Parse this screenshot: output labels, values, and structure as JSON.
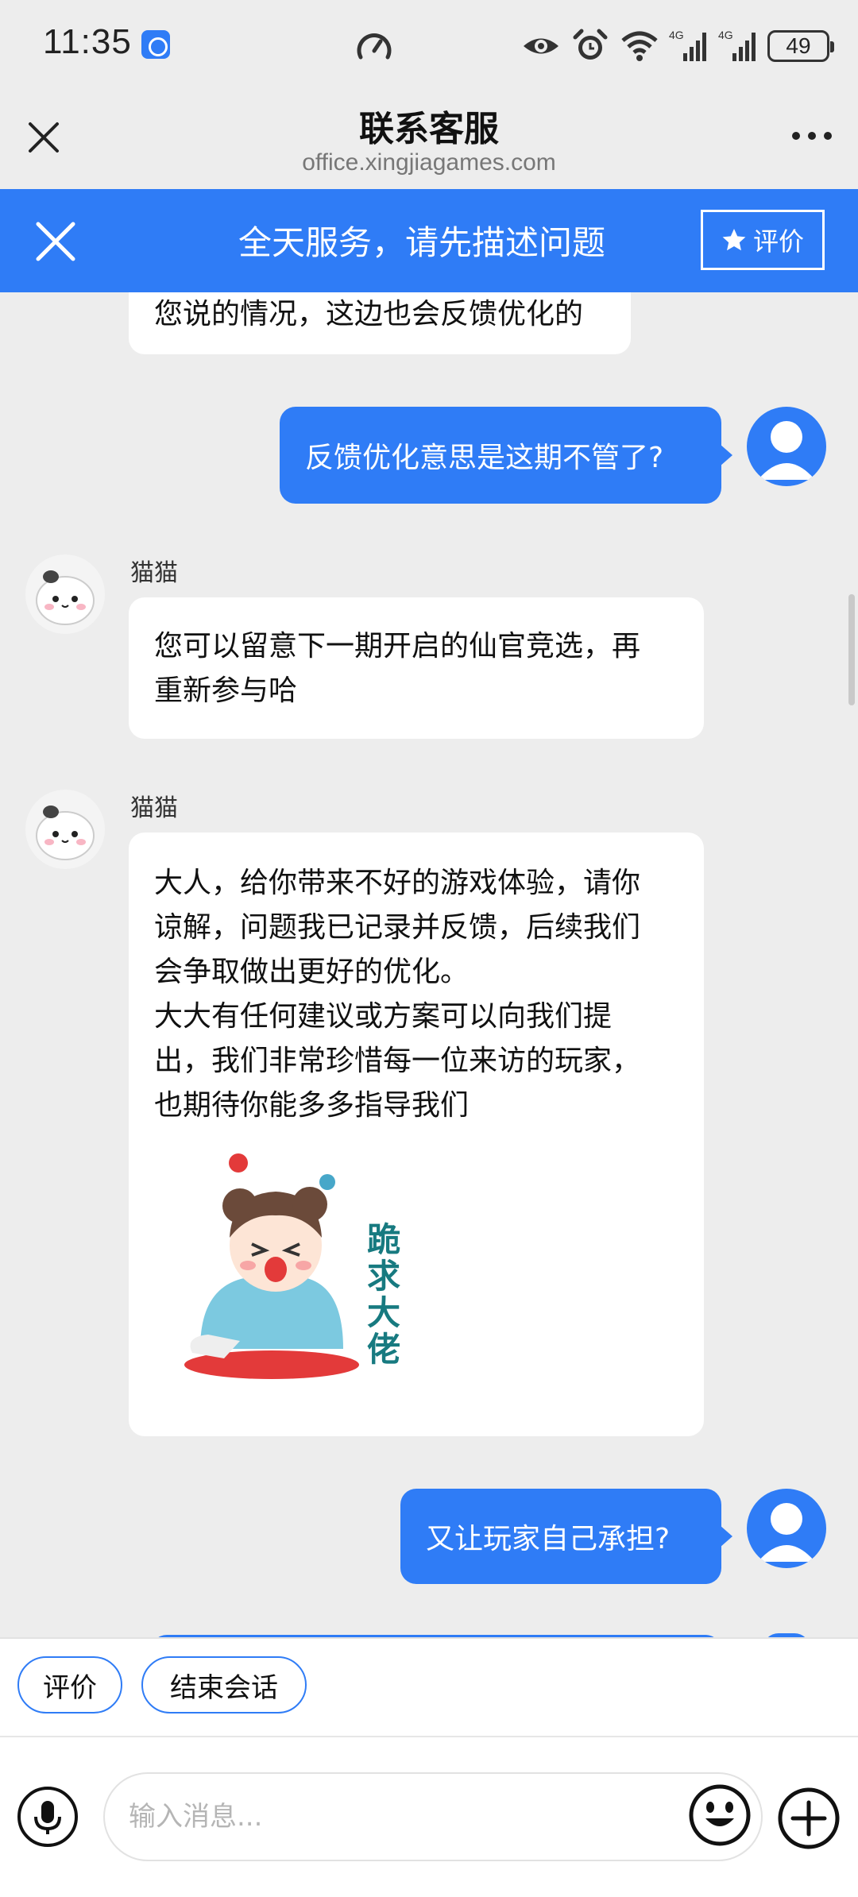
{
  "status_bar": {
    "time": "11:35",
    "battery": "49",
    "icons": [
      "speed-gauge-icon",
      "eye-icon",
      "alarm-icon",
      "wifi-icon",
      "4g-signal-icon",
      "4g-signal-icon"
    ]
  },
  "nav": {
    "title": "联系客服",
    "subtitle": "office.xingjiagames.com"
  },
  "banner": {
    "text": "全天服务，请先描述问题",
    "rate_label": "评价"
  },
  "chat": {
    "messages": [
      {
        "role": "agent",
        "text": "您说的情况，这边也会反馈优化的"
      },
      {
        "role": "user",
        "text": "反馈优化意思是这期不管了?"
      },
      {
        "role": "agent",
        "name": "猫猫",
        "lines": [
          "您可以留意下一期开启的仙官竞选，再",
          "重新参与哈"
        ]
      },
      {
        "role": "agent",
        "name": "猫猫",
        "lines": [
          "大人，给你带来不好的游戏体验，请你",
          "谅解，问题我已记录并反馈，后续我们",
          "会争取做出更好的优化。",
          "大大有任何建议或方案可以向我们提",
          "出，我们非常珍惜每一位来访的玩家，",
          "也期待你能多多指导我们"
        ],
        "sticker_text": "跪求大佬"
      },
      {
        "role": "user",
        "text": "又让玩家自己承担?"
      }
    ]
  },
  "quick_actions": [
    "评价",
    "结束会话"
  ],
  "input": {
    "placeholder": "输入消息..."
  },
  "colors": {
    "accent": "#2f7cf6",
    "background": "#ededed",
    "bubble_agent": "#ffffff"
  }
}
